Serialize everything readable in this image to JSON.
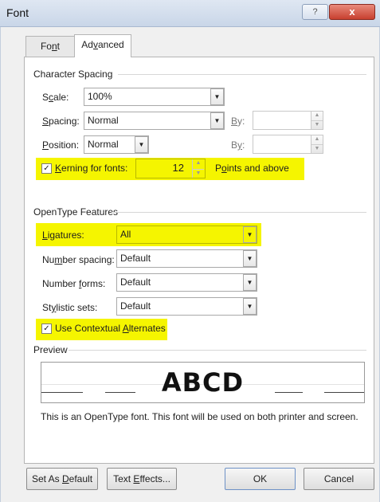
{
  "window": {
    "title": "Font",
    "help_glyph": "?",
    "close_glyph": "x"
  },
  "tabs": [
    {
      "label_pre": "Fo",
      "label_u": "n",
      "label_post": "t"
    },
    {
      "label_pre": "Ad",
      "label_u": "v",
      "label_post": "anced"
    }
  ],
  "character_spacing": {
    "heading": "Character Spacing",
    "scale_label_pre": "S",
    "scale_label_u": "c",
    "scale_label_post": "ale:",
    "scale_value": "100%",
    "spacing_label_u": "S",
    "spacing_label_post": "pacing:",
    "spacing_value": "Normal",
    "by_label_1_u": "B",
    "by_label_1_post": "y:",
    "position_label_u": "P",
    "position_label_post": "osition:",
    "position_value": "Normal",
    "by_label_2_pre": "B",
    "by_label_2_u": "y",
    "by_label_2_post": ":",
    "kerning_label_u": "K",
    "kerning_label_post": "erning for fonts:",
    "kerning_checked": true,
    "kerning_value": "12",
    "points_label_pre": "P",
    "points_label_u": "o",
    "points_label_post": "ints and above"
  },
  "opentype": {
    "heading": "OpenType Features",
    "ligatures_label_u": "L",
    "ligatures_label_post": "igatures:",
    "ligatures_value": "All",
    "number_spacing_label_pre": "Nu",
    "number_spacing_label_u": "m",
    "number_spacing_label_post": "ber spacing:",
    "number_spacing_value": "Default",
    "number_forms_label_pre": "Number ",
    "number_forms_label_u": "f",
    "number_forms_label_post": "orms:",
    "number_forms_value": "Default",
    "stylistic_label_pre": "St",
    "stylistic_label_u": "y",
    "stylistic_label_post": "listic sets:",
    "stylistic_value": "Default",
    "contextual_label_pre": "Use Contextual ",
    "contextual_label_u": "A",
    "contextual_label_post": "lternates",
    "contextual_checked": true
  },
  "preview": {
    "heading": "Preview",
    "sample": "ABCD",
    "note": "This is an OpenType font. This font will be used on both printer and screen."
  },
  "buttons": {
    "set_default_pre": "Set As ",
    "set_default_u": "D",
    "set_default_post": "efault",
    "text_effects_pre": "Text ",
    "text_effects_u": "E",
    "text_effects_post": "ffects...",
    "ok": "OK",
    "cancel": "Cancel"
  },
  "colors": {
    "highlight": "#f5f500",
    "title_bar": "#c9d6e8",
    "close_button": "#c7402f"
  }
}
